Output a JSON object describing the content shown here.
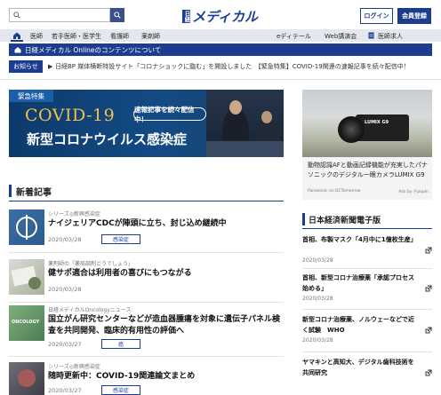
{
  "header": {
    "search_placeholder": "",
    "logo_badge": "日経",
    "logo_word": "メディカル",
    "login_label": "ログイン",
    "register_label": "会員登録"
  },
  "nav": {
    "items": [
      {
        "label": "医師"
      },
      {
        "label": "若手医師・医学生"
      },
      {
        "label": "看護師"
      },
      {
        "label": "薬剤師"
      },
      {
        "label": "eディテール"
      },
      {
        "label": "Web講演会"
      },
      {
        "label": "医師求人"
      }
    ]
  },
  "online_bar": {
    "text": "日経メディカル Onlineのコンテンツについて"
  },
  "notice": {
    "label": "お知らせ",
    "arrow": "▶",
    "text": "日経BP 媒体横断特設サイト「コロナショックに臨む」を開設しました　【緊急特集】COVID-19関連の速報記事を続々配信中！"
  },
  "banner": {
    "tag": "緊急特集",
    "covid": "COVID-19",
    "pill": "速報記事を続々配信中！",
    "title": "新型コロナウイルス感染症"
  },
  "ad": {
    "camera_brand": "LUMIX G9",
    "copy": "動物認識AFと動画記録機能が充実したパナソニックのデジタル一眼カメラLUMIX G9",
    "source": "Panasonic on DCTomorrow",
    "ads_by": "Ads by ⓟpopIn"
  },
  "new_articles": {
    "title": "新着記事",
    "items": [
      {
        "kicker": "シリーズ◎新興感染症",
        "title": "ナイジェリアCDCが陣頭に立ち、封じ込め継続中",
        "date": "2020/03/28",
        "tag": "感染症"
      },
      {
        "kicker": "薬剤師の「薬局調剤どうでしょう」",
        "title": "健サポ適合は利用者の喜びにもつながる",
        "date": "2020/03/28",
        "tag": ""
      },
      {
        "kicker": "日経メディカルOncologyニュース",
        "title": "国立がん研究センターなどが造血器腫瘍を対象に遺伝子パネル検査を共同開発、臨床的有用性の評価へ",
        "date": "2020/03/27",
        "tag": "癌"
      },
      {
        "kicker": "シリーズ◎新興感染症",
        "title": "随時更新中：COVID-19関連論文まとめ",
        "date": "2020/03/27",
        "tag": "感染症"
      }
    ]
  },
  "nikkei": {
    "title": "日本経済新聞電子版",
    "items": [
      {
        "title": "首相、布製マスク「4月中に1億枚生産」",
        "date": "2020/03/28"
      },
      {
        "title": "首相、新型コロナ治療薬「承認プロセス始める」",
        "date": "2020/03/28"
      },
      {
        "title": "新型コロナ治療薬、ノルウェーなどで近く試験　WHO",
        "date": "2020/03/28"
      },
      {
        "title": "ヤマキンと高知大、デジタル歯科技術を共同研究",
        "date": ""
      }
    ]
  }
}
